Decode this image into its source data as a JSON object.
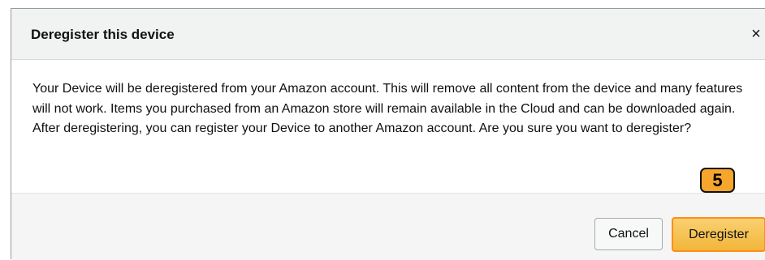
{
  "dialog": {
    "title": "Deregister this device",
    "close_label": "×",
    "message": "Your Device will be deregistered from your Amazon account. This will remove all content from the device and many features will not work. Items you purchased from an Amazon store will remain available in the Cloud and can be downloaded again. After deregistering, you can register your Device to another Amazon account. Are you sure you want to deregister?",
    "cancel_label": "Cancel",
    "confirm_label": "Deregister"
  },
  "annotation": {
    "step_number": "5"
  },
  "colors": {
    "primary_button": "#f2b63a",
    "primary_button_border": "#ff8d1a",
    "header_bg": "#f1f2f2",
    "footer_bg": "#f5f5f5",
    "step_badge": "#f7a62d"
  }
}
